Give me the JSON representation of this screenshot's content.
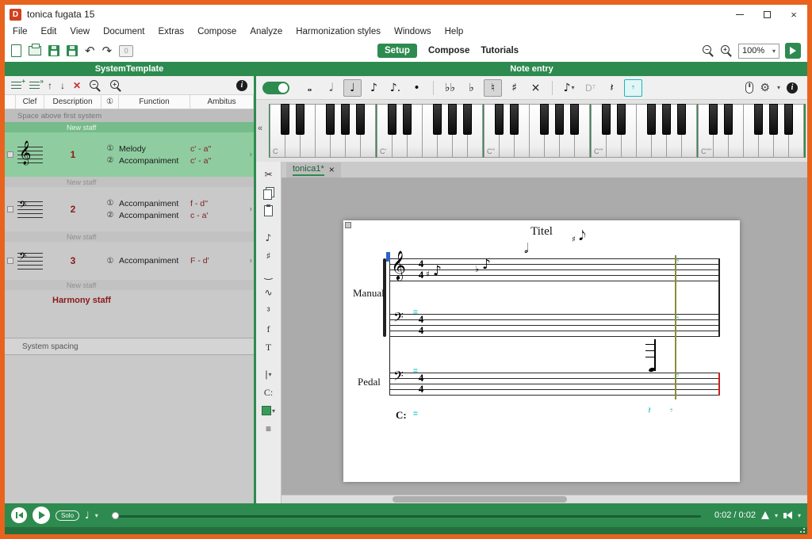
{
  "window": {
    "title": "tonica fugata 15"
  },
  "icons": {
    "app_logo": "D",
    "undo": "↶",
    "redo": "↷",
    "ref_badge": "0",
    "minus": "−",
    "plus": "+",
    "info": "i",
    "up_arrow": "↑",
    "down_arrow": "↓",
    "delete": "✕",
    "add_badge": "+",
    "insert_badge": "»",
    "chevron_down": "▾",
    "row_chevron": "›",
    "scroll_left": "«",
    "treble_clef": "𝄞",
    "bass_clef": "𝄢",
    "close_tab": "×",
    "gear": "⚙"
  },
  "menu_bar": {
    "items": [
      "File",
      "Edit",
      "View",
      "Document",
      "Extras",
      "Compose",
      "Analyze",
      "Harmonization styles",
      "Windows",
      "Help"
    ]
  },
  "toolbar": {
    "mode_tabs": [
      "Setup",
      "Compose",
      "Tutorials"
    ],
    "zoom_value": "100%"
  },
  "system_template": {
    "title": "SystemTemplate",
    "columns": [
      "Clef",
      "Description",
      "①",
      "Function",
      "Ambitus"
    ],
    "space_above_label": "Space above first system",
    "new_staff_label": "New staff",
    "staves": [
      {
        "number": "1",
        "voices": [
          {
            "index": "①",
            "function": "Melody",
            "ambitus": "c' - a''"
          },
          {
            "index": "②",
            "function": "Accompaniment",
            "ambitus": "c' - a''"
          }
        ]
      },
      {
        "number": "2",
        "voices": [
          {
            "index": "①",
            "function": "Accompaniment",
            "ambitus": "f - d''"
          },
          {
            "index": "②",
            "function": "Accompaniment",
            "ambitus": "c - a'"
          }
        ]
      },
      {
        "number": "3",
        "voices": [
          {
            "index": "①",
            "function": "Accompaniment",
            "ambitus": "F - d'"
          }
        ]
      }
    ],
    "harmony_staff_label": "Harmony staff",
    "system_spacing_label": "System spacing"
  },
  "note_entry": {
    "title": "Note entry",
    "durations": [
      "𝅝",
      "𝅗𝅥",
      "♩",
      "♪",
      "♪.",
      "•"
    ],
    "accidentals": [
      "♭♭",
      "♭",
      "♮",
      "♯",
      "×"
    ],
    "note_dropdown": "♪",
    "chord_label": "D⁷",
    "rests": [
      "𝄽",
      "𝄾"
    ]
  },
  "keyboard": {
    "octave_labels": [
      "C",
      "C'",
      "C''",
      "C'''",
      "C''''"
    ]
  },
  "edit_tools": {
    "chord_label": "C:",
    "glyphs": {
      "cut": "✂",
      "note": "♪",
      "sharp": "♯",
      "tie": "‿",
      "orn": "∿",
      "tuplet": "³",
      "dyn": "f",
      "text": "T",
      "barline": "|",
      "layout": "≡"
    }
  },
  "document": {
    "tab_label": "tonica1*",
    "title": "Titel",
    "manual_label": "Manual",
    "pedal_label": "Pedal",
    "harmony_label": "C:",
    "time_top": "4",
    "time_bottom": "4",
    "glyphs": {
      "sharp": "♯",
      "flat": "♭",
      "half_note": "𝅗𝅥",
      "eighth_note": "♪",
      "eighth_note_up": "𝅘𝅥𝅮",
      "quarter_rest": "𝄽",
      "eighth_rest": "𝄾",
      "beat_mark": "="
    }
  },
  "playback": {
    "solo": "Solo",
    "time": "0:02 / 0:02"
  }
}
